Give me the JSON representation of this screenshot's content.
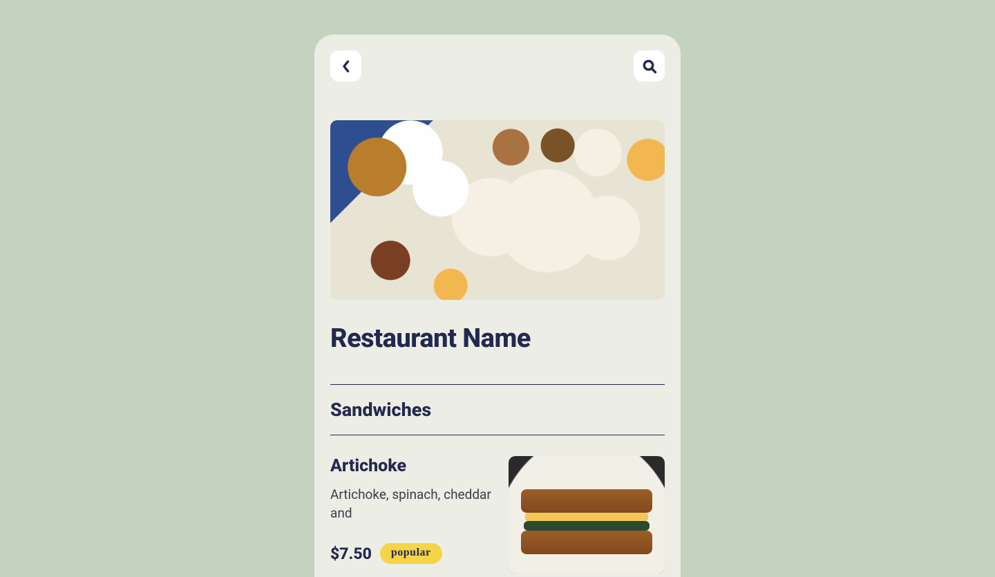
{
  "restaurant": {
    "title": "Restaurant Name"
  },
  "section": {
    "title": "Sandwiches"
  },
  "item": {
    "name": "Artichoke",
    "description": "Artichoke, spinach, cheddar and",
    "price": "$7.50",
    "tag": "popular"
  }
}
